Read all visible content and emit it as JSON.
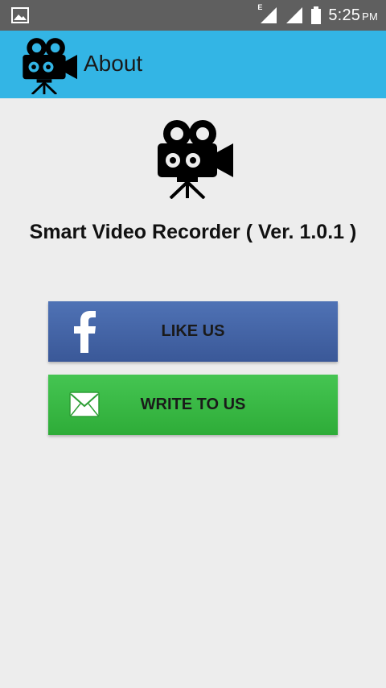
{
  "status_bar": {
    "network_type": "E",
    "time": "5:25",
    "ampm": "PM",
    "icons": [
      "image-notification-icon",
      "signal-icon",
      "signal-icon",
      "battery-icon"
    ]
  },
  "app_bar": {
    "title": "About",
    "logo_icon": "video-camera-icon"
  },
  "content": {
    "app_name": "Smart Video Recorder ( Ver. 1.0.1 )",
    "logo_icon": "video-camera-icon"
  },
  "buttons": {
    "like_label": "LIKE US",
    "like_icon": "facebook-icon",
    "write_label": "WRITE TO US",
    "write_icon": "mail-icon"
  },
  "colors": {
    "status_bar": "#5f5f5f",
    "app_bar": "#33b5e5",
    "background": "#ededed",
    "facebook_blue": "#3b5998",
    "write_green": "#3bbb45"
  }
}
